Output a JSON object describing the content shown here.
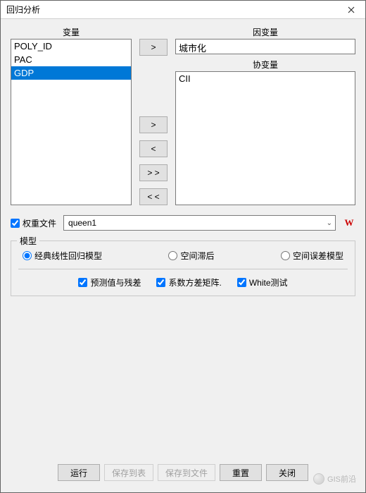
{
  "window": {
    "title": "回归分析"
  },
  "headings": {
    "variables": "变量",
    "dependent": "因变量",
    "covariates": "协变量"
  },
  "variables_list": {
    "items": [
      "POLY_ID",
      "PAC",
      "GDP"
    ],
    "selected_index": 2
  },
  "dependent_value": "城市化",
  "covariates_list": {
    "items": [
      "CII"
    ]
  },
  "transfer_buttons": {
    "to_dep": ">",
    "add": ">",
    "remove": "<",
    "add_all": "> >",
    "remove_all": "< <"
  },
  "weights": {
    "checkbox_label": "权重文件",
    "checked": true,
    "value": "queen1",
    "icon_glyph": "W"
  },
  "model_group": {
    "title": "模型",
    "radios": {
      "classic": "经典线性回归模型",
      "lag": "空间滞后",
      "error": "空间误差模型"
    },
    "selected": "classic",
    "checks": {
      "pred_resid": {
        "label": "预测值与残差",
        "checked": true
      },
      "coeff_cov": {
        "label": "系数方差矩阵.",
        "checked": true
      },
      "white": {
        "label": "White测试",
        "checked": true
      }
    }
  },
  "buttons": {
    "run": "运行",
    "save_table": "保存到表",
    "save_file": "保存到文件",
    "reset": "重置",
    "close": "关闭"
  },
  "watermark": "GIS前沿"
}
